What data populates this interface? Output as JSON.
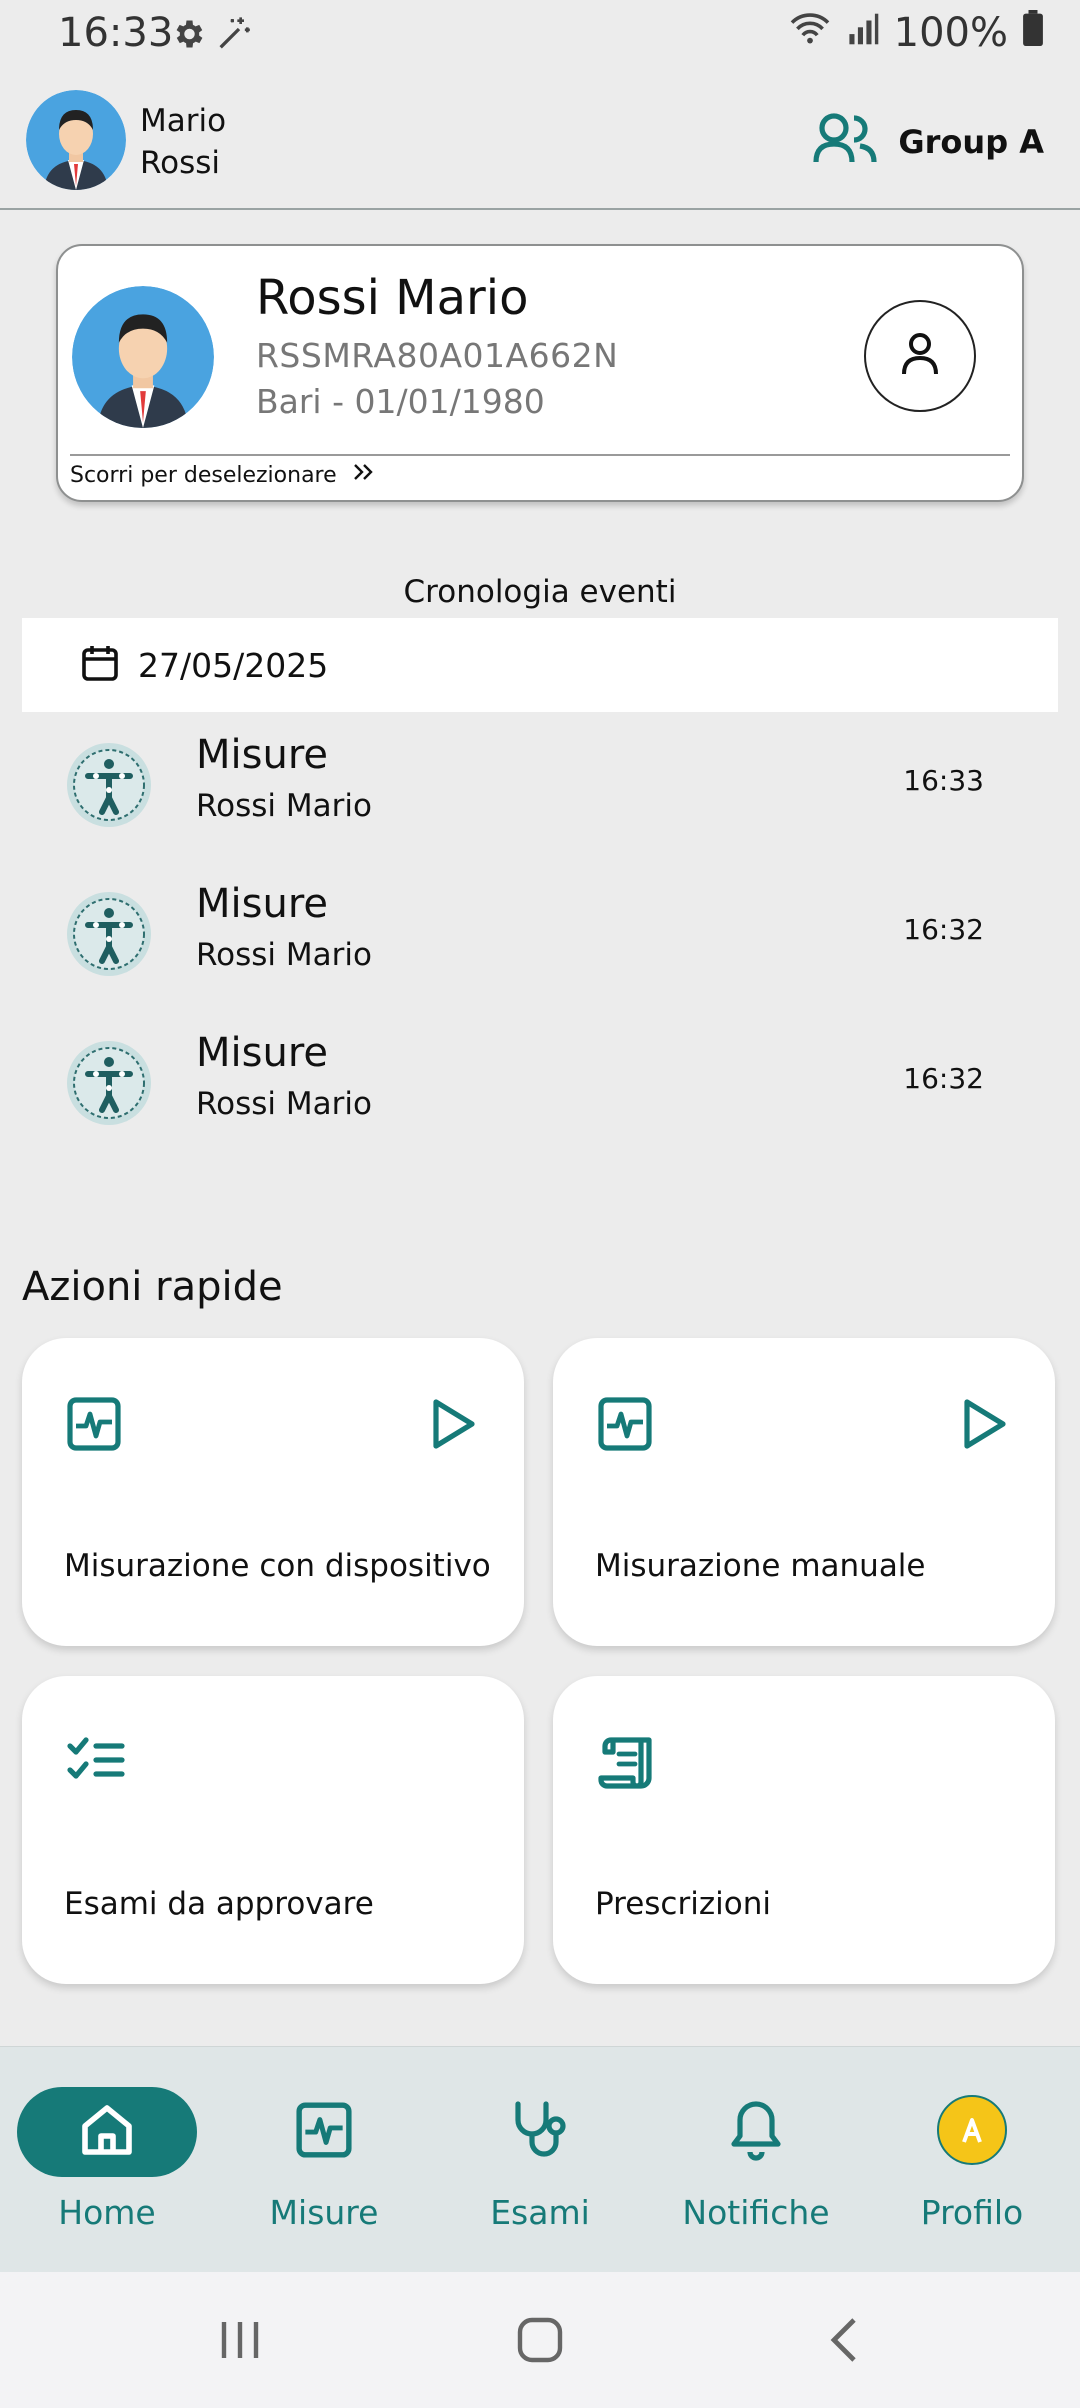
{
  "status_bar": {
    "time": "16:33",
    "battery": "100%",
    "icons": [
      "gear-icon",
      "magic-wand-icon",
      "wifi-icon",
      "signal-icon",
      "battery-icon"
    ]
  },
  "header": {
    "user_first": "Mario",
    "user_last": "Rossi",
    "group_label": "Group A"
  },
  "patient": {
    "name": "Rossi Mario",
    "fiscal_code": "RSSMRA80A01A662N",
    "birth": "Bari - 01/01/1980",
    "swipe_hint": "Scorri per deselezionare"
  },
  "timeline": {
    "title": "Cronologia eventi",
    "date": "27/05/2025",
    "events": [
      {
        "type": "Misure",
        "person": "Rossi Mario",
        "time": "16:33"
      },
      {
        "type": "Misure",
        "person": "Rossi Mario",
        "time": "16:32"
      },
      {
        "type": "Misure",
        "person": "Rossi Mario",
        "time": "16:32"
      }
    ]
  },
  "quick_actions": {
    "title": "Azioni rapide",
    "items": [
      {
        "label": "Misurazione con dispositivo"
      },
      {
        "label": "Misurazione manuale"
      },
      {
        "label": "Esami da approvare"
      },
      {
        "label": "Prescrizioni"
      }
    ]
  },
  "bottom_nav": {
    "items": [
      {
        "label": "Home"
      },
      {
        "label": "Misure"
      },
      {
        "label": "Esami"
      },
      {
        "label": "Notifiche"
      },
      {
        "label": "Profilo"
      }
    ]
  },
  "colors": {
    "accent": "#167a78",
    "background": "#ececec",
    "nav_background": "#dfe6e7",
    "profile_badge": "#f5c518"
  }
}
